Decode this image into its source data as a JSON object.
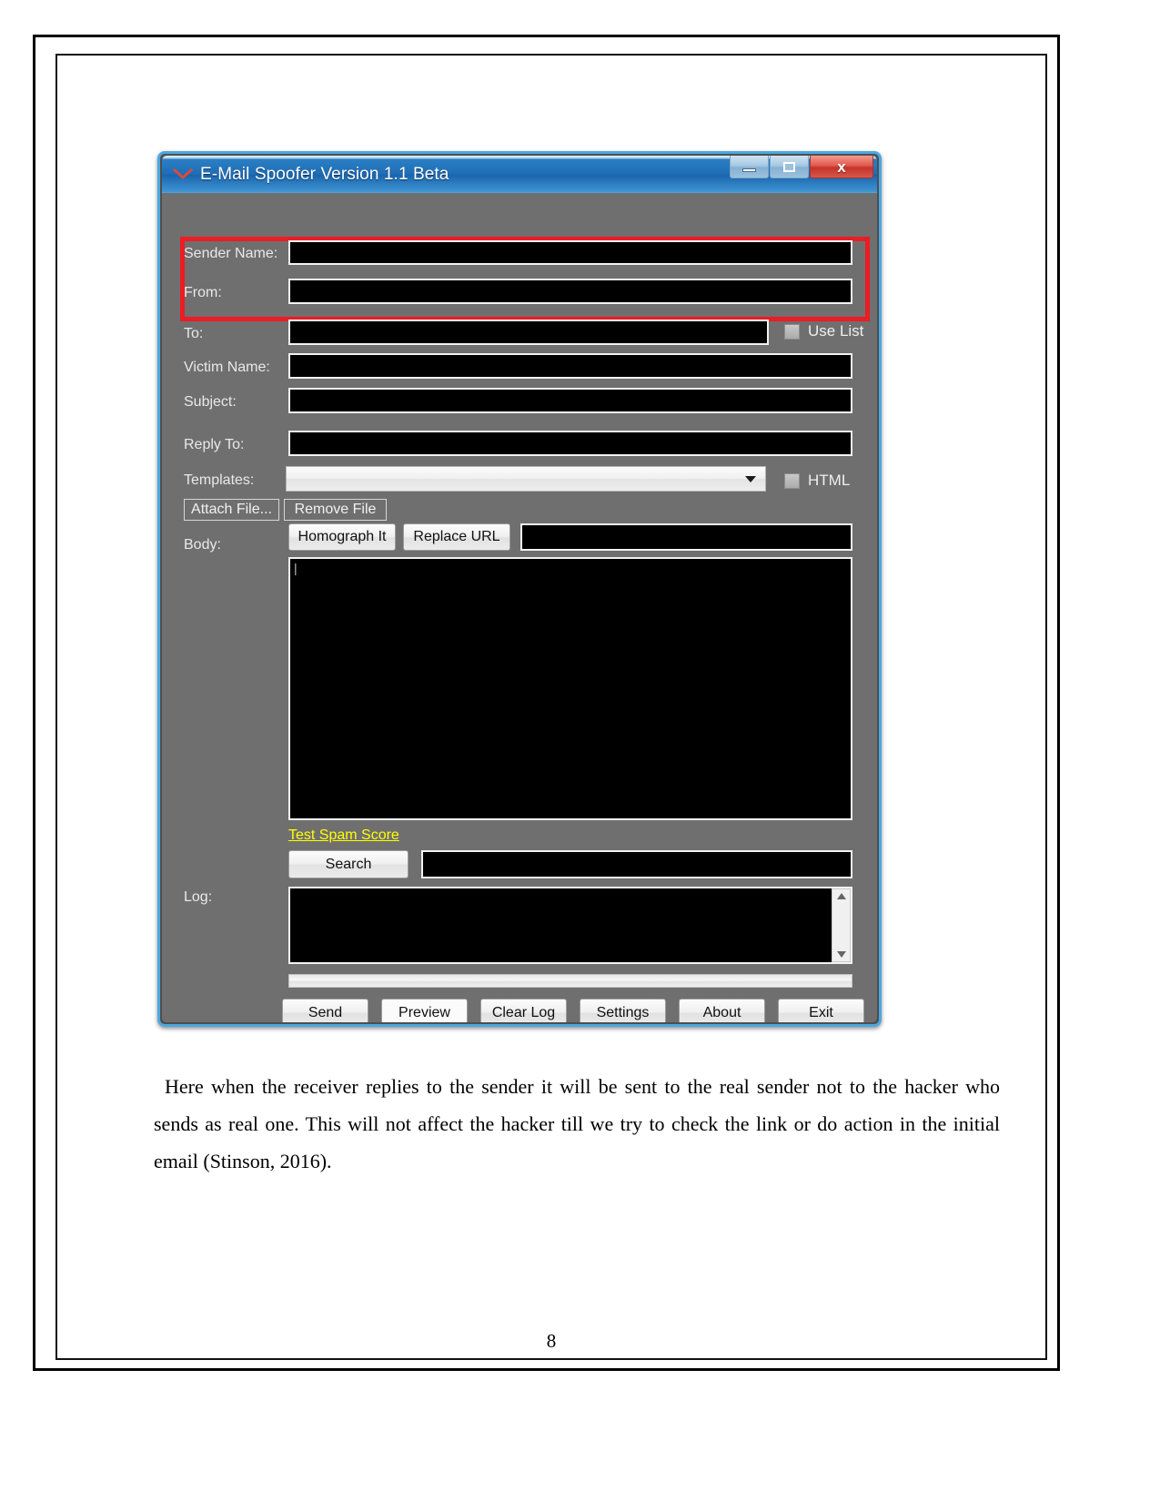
{
  "document": {
    "page_number": "8",
    "paragraph": "Here when the receiver replies to the sender it will be sent to the real sender not to the hacker who sends as real one. This will not affect the hacker till we try to check the link or do action in the initial email (Stinson, 2016)."
  },
  "app": {
    "title": "E-Mail Spoofer Version 1.1 Beta",
    "title_icon": "envelope-icon",
    "window_controls": {
      "minimize": "minimize-icon",
      "maximize": "maximize-icon",
      "close": "x"
    },
    "highlight_color": "#ec1c24",
    "accent_color": "#4ca8e0",
    "link_color": "#ffff00",
    "fields": {
      "sender_name_label": "Sender Name:",
      "sender_name_value": "",
      "from_label": "From:",
      "from_value": "",
      "to_label": "To:",
      "to_value": "",
      "use_list_label": "Use List",
      "use_list_checked": false,
      "victim_name_label": "Victim Name:",
      "victim_name_value": "",
      "subject_label": "Subject:",
      "subject_value": "",
      "reply_to_label": "Reply To:",
      "reply_to_value": "",
      "templates_label": "Templates:",
      "templates_value": "",
      "html_label": "HTML",
      "html_checked": false,
      "body_label": "Body:",
      "body_value": "",
      "url_value": "",
      "search_value": "",
      "log_label": "Log:",
      "log_value": ""
    },
    "buttons": {
      "attach_file": "Attach File...",
      "remove_file": "Remove File",
      "homograph_it": "Homograph It",
      "replace_url": "Replace URL",
      "search": "Search",
      "test_spam_score": "Test Spam Score"
    },
    "footer_buttons": [
      {
        "label": "Send"
      },
      {
        "label": "Preview"
      },
      {
        "label": "Clear Log"
      },
      {
        "label": "Settings"
      },
      {
        "label": "About"
      },
      {
        "label": "Exit"
      }
    ]
  }
}
